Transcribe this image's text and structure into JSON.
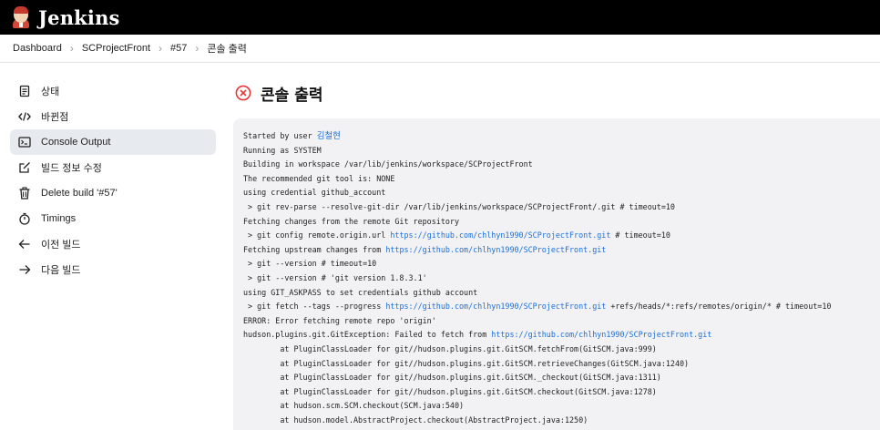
{
  "header": {
    "brand": "Jenkins"
  },
  "breadcrumb": {
    "items": [
      "Dashboard",
      "SCProjectFront",
      "#57",
      "콘솔 출력"
    ]
  },
  "sidebar": {
    "items": [
      {
        "label": "상태",
        "icon": "document-icon"
      },
      {
        "label": "바뀐점",
        "icon": "code-icon"
      },
      {
        "label": "Console Output",
        "icon": "terminal-icon",
        "active": true
      },
      {
        "label": "빌드 정보 수정",
        "icon": "edit-icon"
      },
      {
        "label": "Delete build '#57'",
        "icon": "trash-icon"
      },
      {
        "label": "Timings",
        "icon": "stopwatch-icon"
      },
      {
        "label": "이전 빌드",
        "icon": "arrow-left-icon"
      },
      {
        "label": "다음 빌드",
        "icon": "arrow-right-icon"
      }
    ]
  },
  "main": {
    "title": "콘솔 출력",
    "status_color": "#e5383b",
    "console": {
      "lines": [
        {
          "text": "Started by user ",
          "link": "김철현",
          "suffix": "",
          "user": true
        },
        {
          "text": "Running as SYSTEM"
        },
        {
          "text": "Building in workspace /var/lib/jenkins/workspace/SCProjectFront"
        },
        {
          "text": "The recommended git tool is: NONE"
        },
        {
          "text": "using credential github_account"
        },
        {
          "text": " > git rev-parse --resolve-git-dir /var/lib/jenkins/workspace/SCProjectFront/.git # timeout=10"
        },
        {
          "text": "Fetching changes from the remote Git repository"
        },
        {
          "text": " > git config remote.origin.url ",
          "link": "https://github.com/chlhyn1990/SCProjectFront.git",
          "suffix": " # timeout=10"
        },
        {
          "text": "Fetching upstream changes from ",
          "link": "https://github.com/chlhyn1990/SCProjectFront.git",
          "suffix": ""
        },
        {
          "text": " > git --version # timeout=10"
        },
        {
          "text": " > git --version # 'git version 1.8.3.1'"
        },
        {
          "text": "using GIT_ASKPASS to set credentials github account"
        },
        {
          "text": " > git fetch --tags --progress ",
          "link": "https://github.com/chlhyn1990/SCProjectFront.git",
          "suffix": " +refs/heads/*:refs/remotes/origin/* # timeout=10"
        },
        {
          "text": "ERROR: Error fetching remote repo 'origin'"
        },
        {
          "text": "hudson.plugins.git.GitException: Failed to fetch from ",
          "link": "https://github.com/chlhyn1990/SCProjectFront.git",
          "suffix": ""
        },
        {
          "text": "\tat PluginClassLoader for git//hudson.plugins.git.GitSCM.fetchFrom(GitSCM.java:999)"
        },
        {
          "text": "\tat PluginClassLoader for git//hudson.plugins.git.GitSCM.retrieveChanges(GitSCM.java:1240)"
        },
        {
          "text": "\tat PluginClassLoader for git//hudson.plugins.git.GitSCM._checkout(GitSCM.java:1311)"
        },
        {
          "text": "\tat PluginClassLoader for git//hudson.plugins.git.GitSCM.checkout(GitSCM.java:1278)"
        },
        {
          "text": "\tat hudson.scm.SCM.checkout(SCM.java:540)"
        },
        {
          "text": "\tat hudson.model.AbstractProject.checkout(AbstractProject.java:1250)"
        }
      ]
    }
  }
}
